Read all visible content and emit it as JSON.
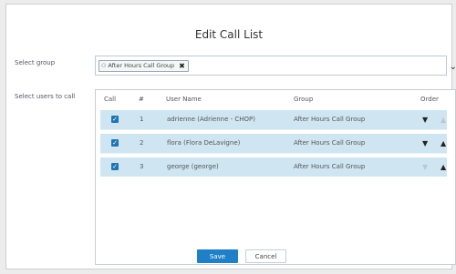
{
  "dialog": {
    "title": "Edit Call List",
    "labels": {
      "select_group": "Select group",
      "select_users": "Select users to call"
    }
  },
  "group_select": {
    "chip_label": "After Hours Call Group",
    "chip_icon": "group-icon",
    "remove_glyph": "✖",
    "dropdown_glyph": "⌄"
  },
  "table": {
    "headers": {
      "call": "Call",
      "num": "#",
      "user_name": "User Name",
      "group": "Group",
      "order": "Order"
    },
    "rows": [
      {
        "checked": true,
        "num": "1",
        "user_name": "adrienne (Adrienne - CHOP)",
        "group": "After Hours Call Group",
        "up_enabled": false,
        "down_enabled": true
      },
      {
        "checked": true,
        "num": "2",
        "user_name": "flora (Flora DeLavigne)",
        "group": "After Hours Call Group",
        "up_enabled": true,
        "down_enabled": true
      },
      {
        "checked": true,
        "num": "3",
        "user_name": "george (george)",
        "group": "After Hours Call Group",
        "up_enabled": true,
        "down_enabled": false
      }
    ]
  },
  "buttons": {
    "save": "Save",
    "cancel": "Cancel"
  },
  "glyphs": {
    "check": "✓",
    "up": "▲",
    "down": "▼"
  },
  "colors": {
    "accent": "#1f80c8",
    "row_selected": "#cfe6f2"
  }
}
